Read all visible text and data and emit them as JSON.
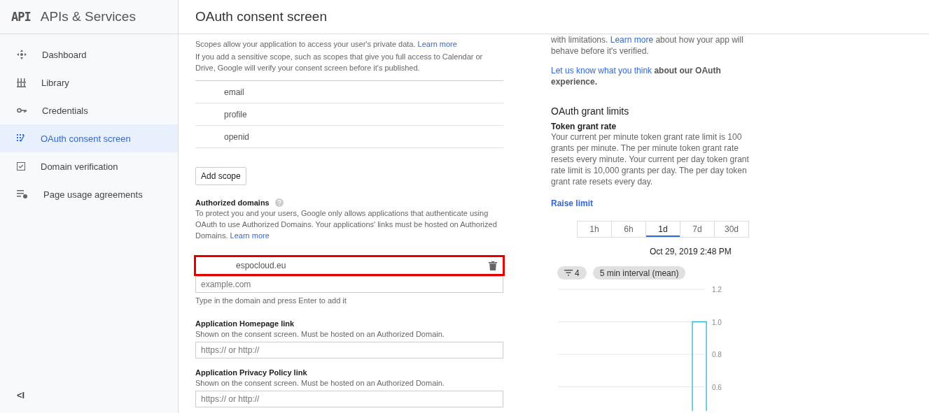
{
  "sidebar": {
    "logo": "API",
    "title": "APIs & Services",
    "items": [
      {
        "label": "Dashboard",
        "selected": false
      },
      {
        "label": "Library",
        "selected": false
      },
      {
        "label": "Credentials",
        "selected": false
      },
      {
        "label": "OAuth consent screen",
        "selected": true
      },
      {
        "label": "Domain verification",
        "selected": false
      },
      {
        "label": "Page usage agreements",
        "selected": false
      }
    ],
    "collapse": "<I"
  },
  "page_title": "OAuth consent screen",
  "scopes": {
    "description": "Scopes allow your application to access your user's private data.",
    "description_link": "Learn more",
    "note": "If you add a sensitive scope, such as scopes that give you full access to Calendar or Drive, Google will verify your consent screen before it's published.",
    "items": [
      "email",
      "profile",
      "openid"
    ],
    "add_button": "Add scope"
  },
  "authorized_domains": {
    "heading": "Authorized domains",
    "description": "To protect you and your users, Google only allows applications that authenticate using OAuth to use Authorized Domains. Your applications' links must be hosted on Authorized Domains.",
    "description_link": "Learn more",
    "domains": [
      {
        "value": "espocloud.eu",
        "highlighted": true
      }
    ],
    "input_placeholder": "example.com",
    "hint": "Type in the domain and press Enter to add it"
  },
  "link_fields": [
    {
      "label": "Application Homepage link",
      "hint": "Shown on the consent screen. Must be hosted on an Authorized Domain.",
      "placeholder": "https:// or http://"
    },
    {
      "label": "Application Privacy Policy link",
      "hint": "Shown on the consent screen. Must be hosted on an Authorized Domain.",
      "placeholder": "https:// or http://"
    }
  ],
  "side": {
    "verify_text_before": "with limitations.",
    "verify_link": "Learn more",
    "verify_text_after": "about how your app will behave before it's verified.",
    "feedback_link": "Let us know what you think",
    "feedback_text": "about our OAuth experience.",
    "limits_title": "OAuth grant limits",
    "rate_title": "Token grant rate",
    "rate_text": "Your current per minute token grant rate limit is 100 grants per minute. The per minute token grant rate resets every minute. Your current per day token grant rate limit is 10,000 grants per day. The per day token grant rate resets every day.",
    "raise_link": "Raise limit",
    "ranges": [
      {
        "label": "1h",
        "selected": false
      },
      {
        "label": "6h",
        "selected": false
      },
      {
        "label": "1d",
        "selected": true
      },
      {
        "label": "7d",
        "selected": false
      },
      {
        "label": "30d",
        "selected": false
      }
    ],
    "timestamp": "Oct 29, 2019 2:48 PM",
    "filter_count": "4",
    "interval": "5 min interval (mean)",
    "chart_axis_labels": [
      "1.2",
      "1.0",
      "0.8",
      "0.6"
    ]
  }
}
